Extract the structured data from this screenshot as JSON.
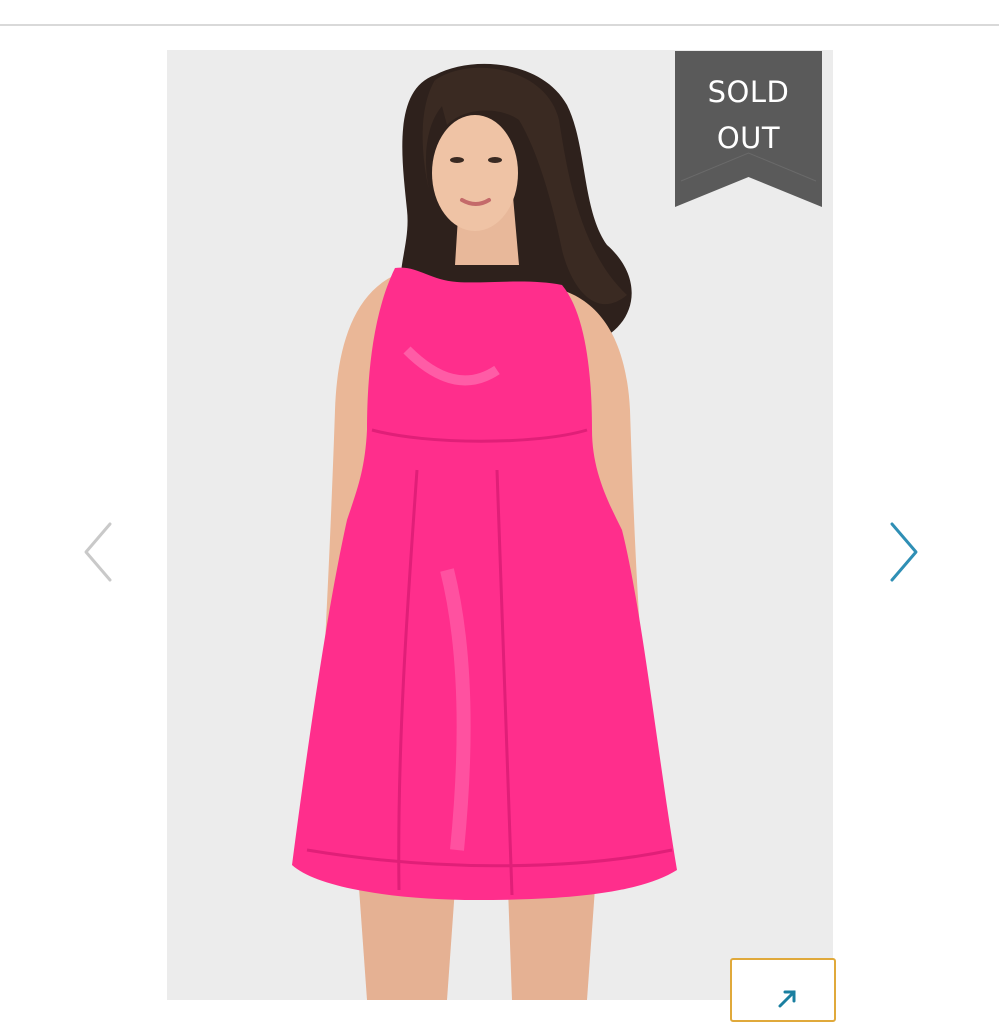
{
  "gallery": {
    "badge": {
      "line1": "SOLD",
      "line2": "OUT"
    },
    "image_icon": "dress-product-photo",
    "prev_icon": "chevron-left-icon",
    "next_icon": "chevron-right-icon",
    "expand_icon": "expand-arrow-icon"
  },
  "colors": {
    "badge_bg": "#5a5a5a",
    "image_bg": "#ececec",
    "dress": "#ff2e8c",
    "arrow_prev": "#c9c9c9",
    "arrow_next": "#2f8fb5",
    "expand_border": "#e0a93b",
    "expand_icon": "#1a7fa0"
  }
}
